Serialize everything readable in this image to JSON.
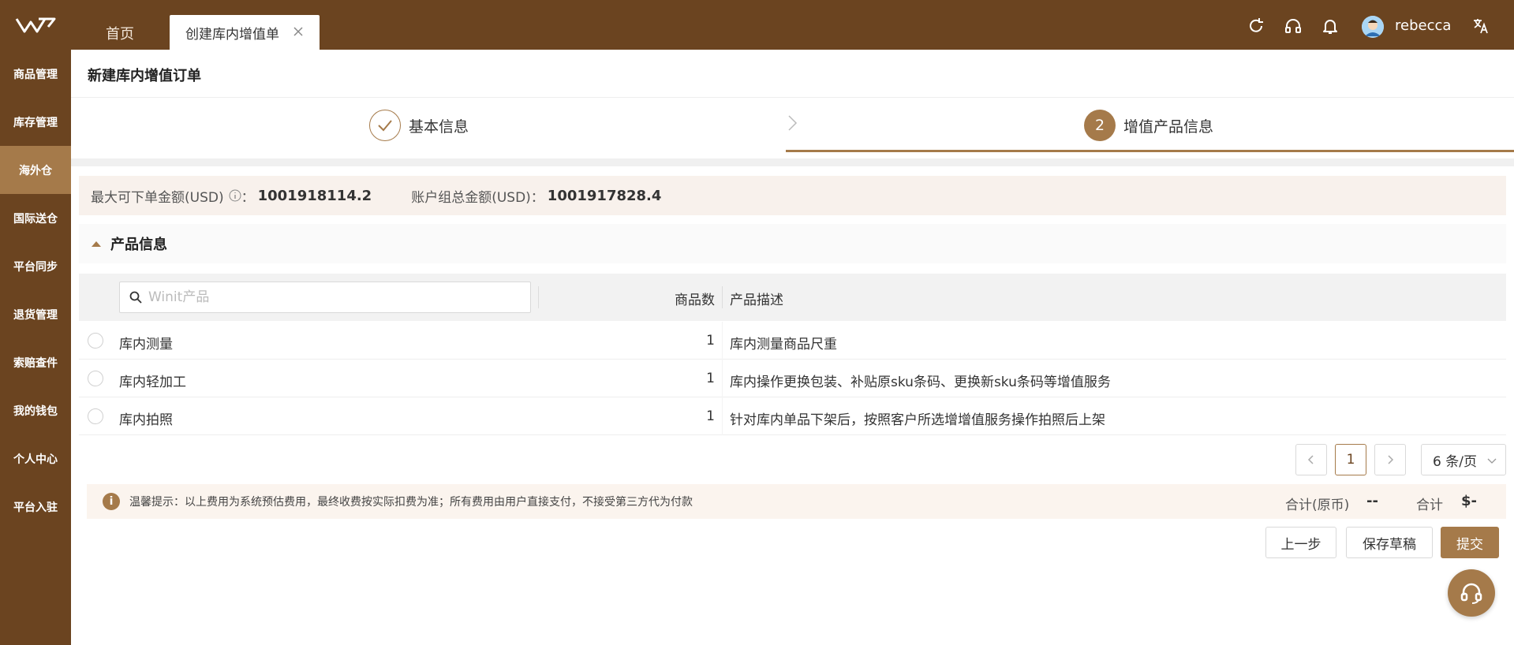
{
  "colors": {
    "brand": "#6b4420",
    "accent": "#a57a4a"
  },
  "header": {
    "tabs": [
      {
        "label": "首页"
      },
      {
        "label": "创建库内增值单"
      }
    ],
    "username": "rebecca",
    "icons": [
      "refresh-icon",
      "headset-icon",
      "bell-icon",
      "avatar",
      "translate-icon"
    ]
  },
  "sidebar": {
    "items": [
      {
        "label": "商品管理"
      },
      {
        "label": "库存管理"
      },
      {
        "label": "海外仓"
      },
      {
        "label": "国际送仓"
      },
      {
        "label": "平台同步"
      },
      {
        "label": "退货管理"
      },
      {
        "label": "索赔查件"
      },
      {
        "label": "我的钱包"
      },
      {
        "label": "个人中心"
      },
      {
        "label": "平台入驻"
      }
    ],
    "active_index": 2
  },
  "page": {
    "title": "新建库内增值订单"
  },
  "steps": {
    "step1_label": "基本信息",
    "step2_number": "2",
    "step2_label": "增值产品信息",
    "current": 2
  },
  "amounts": {
    "max_label": "最大可下单金额(USD)",
    "max_value": "1001918114.2",
    "group_label": "账户组总金额(USD)",
    "group_value": "1001917828.4",
    "colon": "："
  },
  "product_section": {
    "title": "产品信息",
    "search_placeholder": "Winit产品",
    "col_count": "商品数",
    "col_desc": "产品描述",
    "rows": [
      {
        "name": "库内测量",
        "count": "1",
        "desc": "库内测量商品尺重"
      },
      {
        "name": "库内轻加工",
        "count": "1",
        "desc": "库内操作更换包装、补贴原sku条码、更换新sku条码等增值服务"
      },
      {
        "name": "库内拍照",
        "count": "1",
        "desc": "针对库内单品下架后，按照客户所选增增值服务操作拍照后上架"
      }
    ]
  },
  "pagination": {
    "current_page": "1",
    "page_size": "6 条/页"
  },
  "tip": {
    "icon_text": "i",
    "text": "温馨提示：以上费用为系统预估费用，最终收费按实际扣费为准；所有费用由用户直接支付，不接受第三方代为付款",
    "total_orig_label": "合计(原币)",
    "total_orig_value": "--",
    "total_label": "合计",
    "total_value": "$-"
  },
  "actions": {
    "prev": "上一步",
    "save": "保存草稿",
    "submit": "提交"
  }
}
